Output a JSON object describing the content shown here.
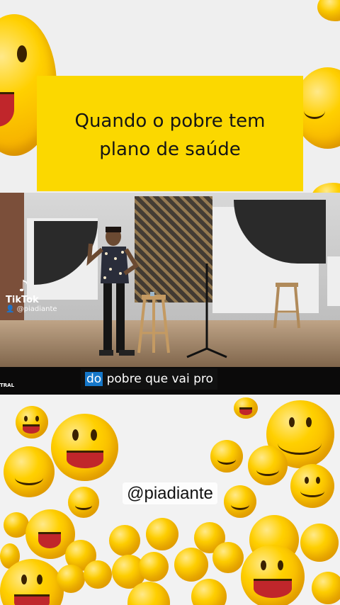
{
  "banner": {
    "text": "Quando o pobre tem\nplano de saúde",
    "color": "#fbd800"
  },
  "video": {
    "channel_tag": "TRAL",
    "caption_highlight": "do",
    "caption_rest": " pobre que vai pro",
    "tiktok_logo": "tiktok-logo-icon",
    "tiktok_label": "TikTok",
    "tiktok_handle": "@piadiante"
  },
  "watermark": {
    "handle": "@piadiante"
  },
  "colors": {
    "emoji": "#ffd000",
    "caption_highlight": "#1577c9"
  }
}
